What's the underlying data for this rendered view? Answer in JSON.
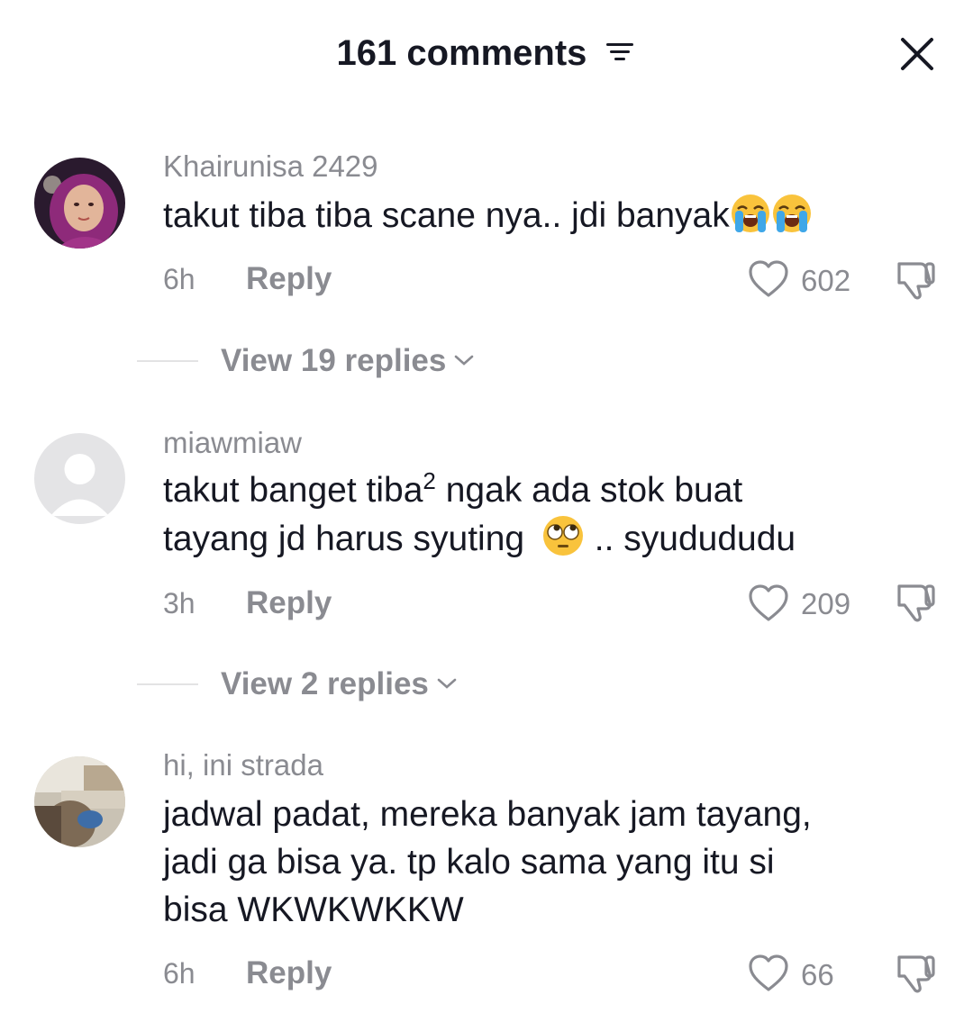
{
  "header": {
    "title": "161 comments",
    "filter_icon": "sort-filter-icon",
    "close_icon": "close-icon"
  },
  "comments": [
    {
      "username": "Khairunisa 2429",
      "text": "takut tiba tiba scane nya.. jdi banyak",
      "emojis": [
        "loudly-crying-face",
        "loudly-crying-face"
      ],
      "time": "6h",
      "reply_label": "Reply",
      "likes": "602",
      "replies_label": "View 19 replies"
    },
    {
      "username": "miawmiaw",
      "text_part1": "takut banget tiba",
      "text_sup": "2",
      "text_part2": " ngak ada stok buat",
      "text_line2a": "tayang jd harus syuting",
      "text_line2b": " .. syudududu",
      "emoji": "face-with-rolling-eyes",
      "time": "3h",
      "reply_label": "Reply",
      "likes": "209",
      "replies_label": "View 2 replies"
    },
    {
      "username": "hi, ini strada",
      "text_line1": "jadwal padat, mereka banyak jam tayang,",
      "text_line2": "jadi ga bisa ya. tp kalo sama yang itu si",
      "text_line3": "bisa WKWKWKKW",
      "time": "6h",
      "reply_label": "Reply",
      "likes": "66"
    }
  ],
  "colors": {
    "text_primary": "#161823",
    "text_secondary": "#8a8b91",
    "divider": "#e3e3e4"
  }
}
